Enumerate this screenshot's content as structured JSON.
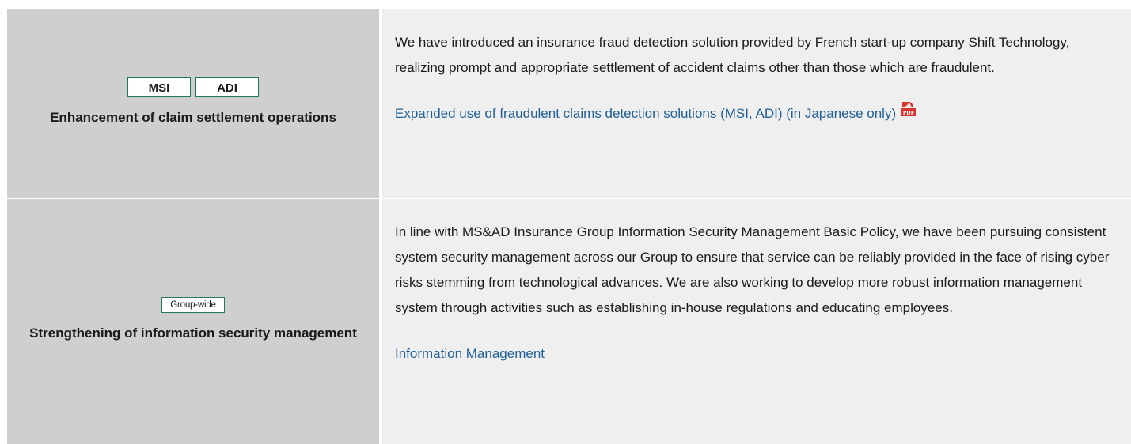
{
  "rows": [
    {
      "badges": [
        "MSI",
        "ADI"
      ],
      "title": "Enhancement of claim settlement operations",
      "description": "We have introduced an insurance fraud detection solution provided by French start-up company Shift Technology, realizing prompt and appropriate settlement of accident claims other than those which are fraudulent.",
      "link_text": "Expanded use of fraudulent claims detection solutions (MSI, ADI) (in Japanese only)",
      "link_icon": "pdf-icon"
    },
    {
      "badges": [
        "Group-wide"
      ],
      "title": "Strengthening of information security management",
      "description": "In line with MS&AD Insurance Group Information Security Management Basic Policy, we have been pursuing consistent system security management across our Group to ensure that service can be reliably provided in the face of rising cyber risks stemming from technological advances. We are also working to develop more robust information management system through activities such as establishing in-house regulations and educating employees.",
      "link_text": "Information Management"
    }
  ],
  "colors": {
    "left_cell_bg": "#cfcfcf",
    "right_cell_bg": "#efefef",
    "badge_border": "#1f7a5a",
    "link": "#1f5e97",
    "pdf_icon": "#d9332b"
  }
}
